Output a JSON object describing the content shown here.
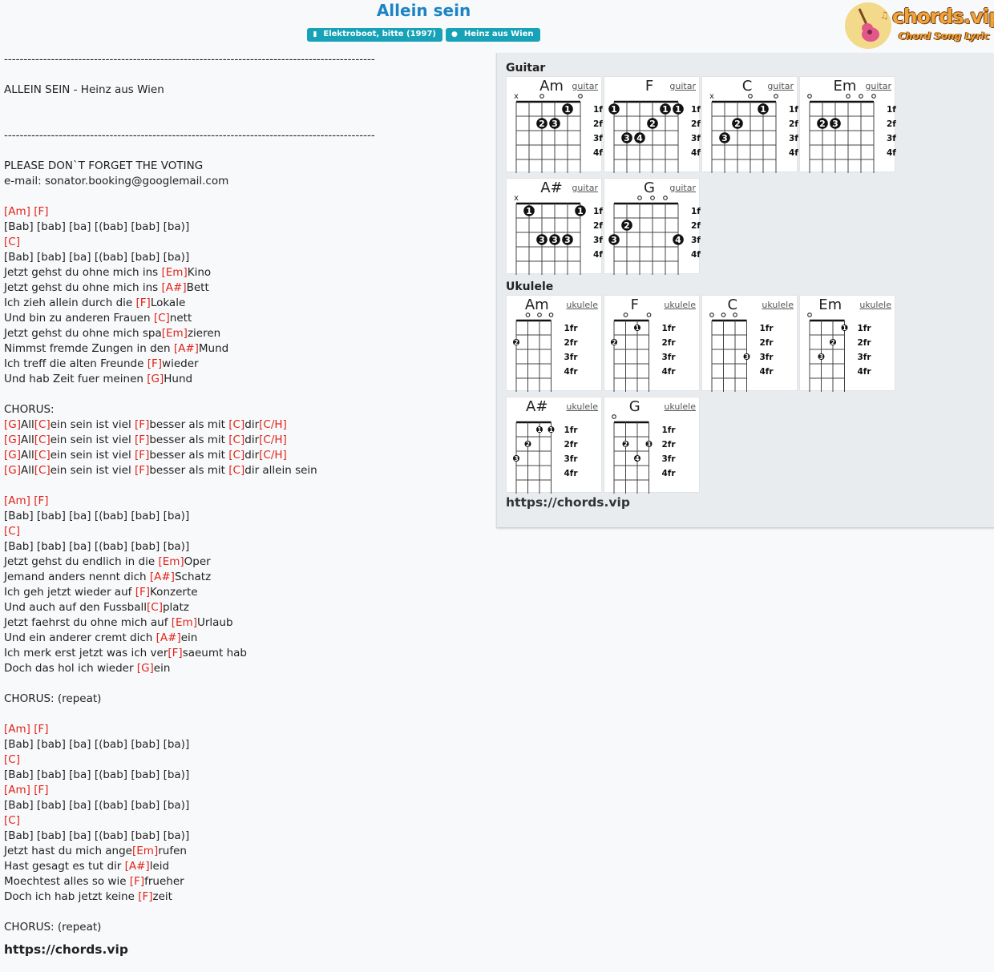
{
  "title": "Allein sein",
  "badges": {
    "album": "Elektroboot, bitte (1997)",
    "artist": "Heinz aus Wien"
  },
  "logo": {
    "name": "chords.vip",
    "tagline": "Chord Song Lyric"
  },
  "lyrics": [
    "-----------------------------------------------------------------------------------------------",
    "",
    "ALLEIN SEIN - Heinz aus Wien",
    "",
    "",
    "-----------------------------------------------------------------------------------------------",
    "",
    "PLEASE DON`T FORGET THE VOTING",
    "e-mail: sonator.booking@googlemail.com",
    "",
    "[Am] [F]",
    "[Bab] [bab] [ba] [(bab] [bab] [ba)]",
    "[C]",
    "[Bab] [bab] [ba] [(bab] [bab] [ba)]",
    "Jetzt gehst du ohne mich ins [Em]Kino",
    "Jetzt gehst du ohne mich ins [A#]Bett",
    "Ich zieh allein durch die [F]Lokale",
    "Und bin zu anderen Frauen [C]nett",
    "Jetzt gehst du ohne mich spa[Em]zieren",
    "Nimmst fremde Zungen in den [A#]Mund",
    "Ich treff die alten Freunde [F]wieder",
    "Und hab Zeit fuer meinen [G]Hund",
    "",
    "CHORUS:",
    "[G]All[C]ein sein ist viel [F]besser als mit [C]dir[C/H]",
    "[G]All[C]ein sein ist viel [F]besser als mit [C]dir[C/H]",
    "[G]All[C]ein sein ist viel [F]besser als mit [C]dir[C/H]",
    "[G]All[C]ein sein ist viel [F]besser als mit [C]dir allein sein",
    "",
    "[Am] [F]",
    "[Bab] [bab] [ba] [(bab] [bab] [ba)]",
    "[C]",
    "[Bab] [bab] [ba] [(bab] [bab] [ba)]",
    "Jetzt gehst du endlich in die [Em]Oper",
    "Jemand anders nennt dich [A#]Schatz",
    "Ich geh jetzt wieder auf [F]Konzerte",
    "Und auch auf den Fussball[C]platz",
    "Jetzt faehrst du ohne mich auf [Em]Urlaub",
    "Und ein anderer cremt dich [A#]ein",
    "Ich merk erst jetzt was ich ver[F]saeumt hab",
    "Doch das hol ich wieder [G]ein",
    "",
    "CHORUS: (repeat)",
    "",
    "[Am] [F]",
    "[Bab] [bab] [ba] [(bab] [bab] [ba)]",
    "[C]",
    "[Bab] [bab] [ba] [(bab] [bab] [ba)]",
    "[Am] [F]",
    "[Bab] [bab] [ba] [(bab] [bab] [ba)]",
    "[C]",
    "[Bab] [bab] [ba] [(bab] [bab] [ba)]",
    "Jetzt hast du mich ange[Em]rufen",
    "Hast gesagt es tut dir [A#]leid",
    "Moechtest alles so wie [F]frueher",
    "Doch ich hab jetzt keine [F]zeit",
    "",
    "CHORUS: (repeat)"
  ],
  "chord_names": [
    "Am",
    "F",
    "C",
    "Em",
    "A#",
    "G",
    "C/H"
  ],
  "site_url": "https://chords.vip",
  "panel": {
    "guitar_title": "Guitar",
    "ukulele_title": "Ukulele",
    "fret_labels": [
      "1fr",
      "2fr",
      "3fr",
      "4fr"
    ],
    "guitar": [
      {
        "name": "Am",
        "link": "guitar",
        "markers": [
          "x",
          "",
          "o",
          "",
          "",
          "o"
        ],
        "dots": [
          {
            "s": 5,
            "f": 1,
            "n": "1"
          },
          {
            "s": 3,
            "f": 2,
            "n": "2"
          },
          {
            "s": 4,
            "f": 2,
            "n": "3"
          }
        ]
      },
      {
        "name": "F",
        "link": "guitar",
        "markers": [
          "",
          "",
          "",
          "",
          "",
          ""
        ],
        "dots": [
          {
            "s": 1,
            "f": 1,
            "n": "1"
          },
          {
            "s": 5,
            "f": 1,
            "n": "1"
          },
          {
            "s": 6,
            "f": 1,
            "n": "1"
          },
          {
            "s": 4,
            "f": 2,
            "n": "2"
          },
          {
            "s": 2,
            "f": 3,
            "n": "3"
          },
          {
            "s": 3,
            "f": 3,
            "n": "4"
          }
        ]
      },
      {
        "name": "C",
        "link": "guitar",
        "markers": [
          "x",
          "",
          "",
          "o",
          "",
          "o"
        ],
        "dots": [
          {
            "s": 5,
            "f": 1,
            "n": "1"
          },
          {
            "s": 3,
            "f": 2,
            "n": "2"
          },
          {
            "s": 2,
            "f": 3,
            "n": "3"
          }
        ]
      },
      {
        "name": "Em",
        "link": "guitar",
        "markers": [
          "o",
          "",
          "",
          "o",
          "o",
          "o"
        ],
        "dots": [
          {
            "s": 2,
            "f": 2,
            "n": "2"
          },
          {
            "s": 3,
            "f": 2,
            "n": "3"
          }
        ]
      },
      {
        "name": "A#",
        "link": "guitar",
        "markers": [
          "x",
          "",
          "",
          "",
          "",
          ""
        ],
        "dots": [
          {
            "s": 2,
            "f": 1,
            "n": "1"
          },
          {
            "s": 6,
            "f": 1,
            "n": "1"
          },
          {
            "s": 3,
            "f": 3,
            "n": "3"
          },
          {
            "s": 4,
            "f": 3,
            "n": "3"
          },
          {
            "s": 5,
            "f": 3,
            "n": "3"
          }
        ]
      },
      {
        "name": "G",
        "link": "guitar",
        "markers": [
          "",
          "",
          "o",
          "o",
          "o",
          ""
        ],
        "dots": [
          {
            "s": 2,
            "f": 2,
            "n": "2"
          },
          {
            "s": 1,
            "f": 3,
            "n": "3"
          },
          {
            "s": 6,
            "f": 3,
            "n": "4"
          }
        ]
      }
    ],
    "ukulele": [
      {
        "name": "Am",
        "link": "ukulele",
        "markers": [
          "",
          "o",
          "o",
          "o"
        ],
        "dots": [
          {
            "s": 1,
            "f": 2,
            "n": "2"
          }
        ]
      },
      {
        "name": "F",
        "link": "ukulele",
        "markers": [
          "",
          "o",
          "",
          "o"
        ],
        "dots": [
          {
            "s": 3,
            "f": 1,
            "n": "1"
          },
          {
            "s": 1,
            "f": 2,
            "n": "2"
          }
        ]
      },
      {
        "name": "C",
        "link": "ukulele",
        "markers": [
          "o",
          "o",
          "o",
          ""
        ],
        "dots": [
          {
            "s": 4,
            "f": 3,
            "n": "3"
          }
        ]
      },
      {
        "name": "Em",
        "link": "ukulele",
        "markers": [
          "o",
          "",
          "",
          ""
        ],
        "dots": [
          {
            "s": 4,
            "f": 1,
            "n": "1"
          },
          {
            "s": 3,
            "f": 2,
            "n": "2"
          },
          {
            "s": 2,
            "f": 3,
            "n": "3"
          }
        ]
      },
      {
        "name": "A#",
        "link": "ukulele",
        "markers": [
          "",
          "",
          "",
          ""
        ],
        "dots": [
          {
            "s": 3,
            "f": 1,
            "n": "1"
          },
          {
            "s": 4,
            "f": 1,
            "n": "1"
          },
          {
            "s": 2,
            "f": 2,
            "n": "2"
          },
          {
            "s": 1,
            "f": 3,
            "n": "3"
          }
        ]
      },
      {
        "name": "G",
        "link": "ukulele",
        "markers": [
          "o",
          "",
          "",
          ""
        ],
        "dots": [
          {
            "s": 2,
            "f": 2,
            "n": "2"
          },
          {
            "s": 4,
            "f": 2,
            "n": "3"
          },
          {
            "s": 3,
            "f": 3,
            "n": "4"
          }
        ]
      }
    ]
  },
  "colors": {
    "title": "#1d84c4",
    "badge": "#17a2b8",
    "chord": "#e2231a",
    "panel_bg": "#e9ecef"
  },
  "icons": {
    "album_badge": "book-icon",
    "artist_badge": "user-icon"
  }
}
